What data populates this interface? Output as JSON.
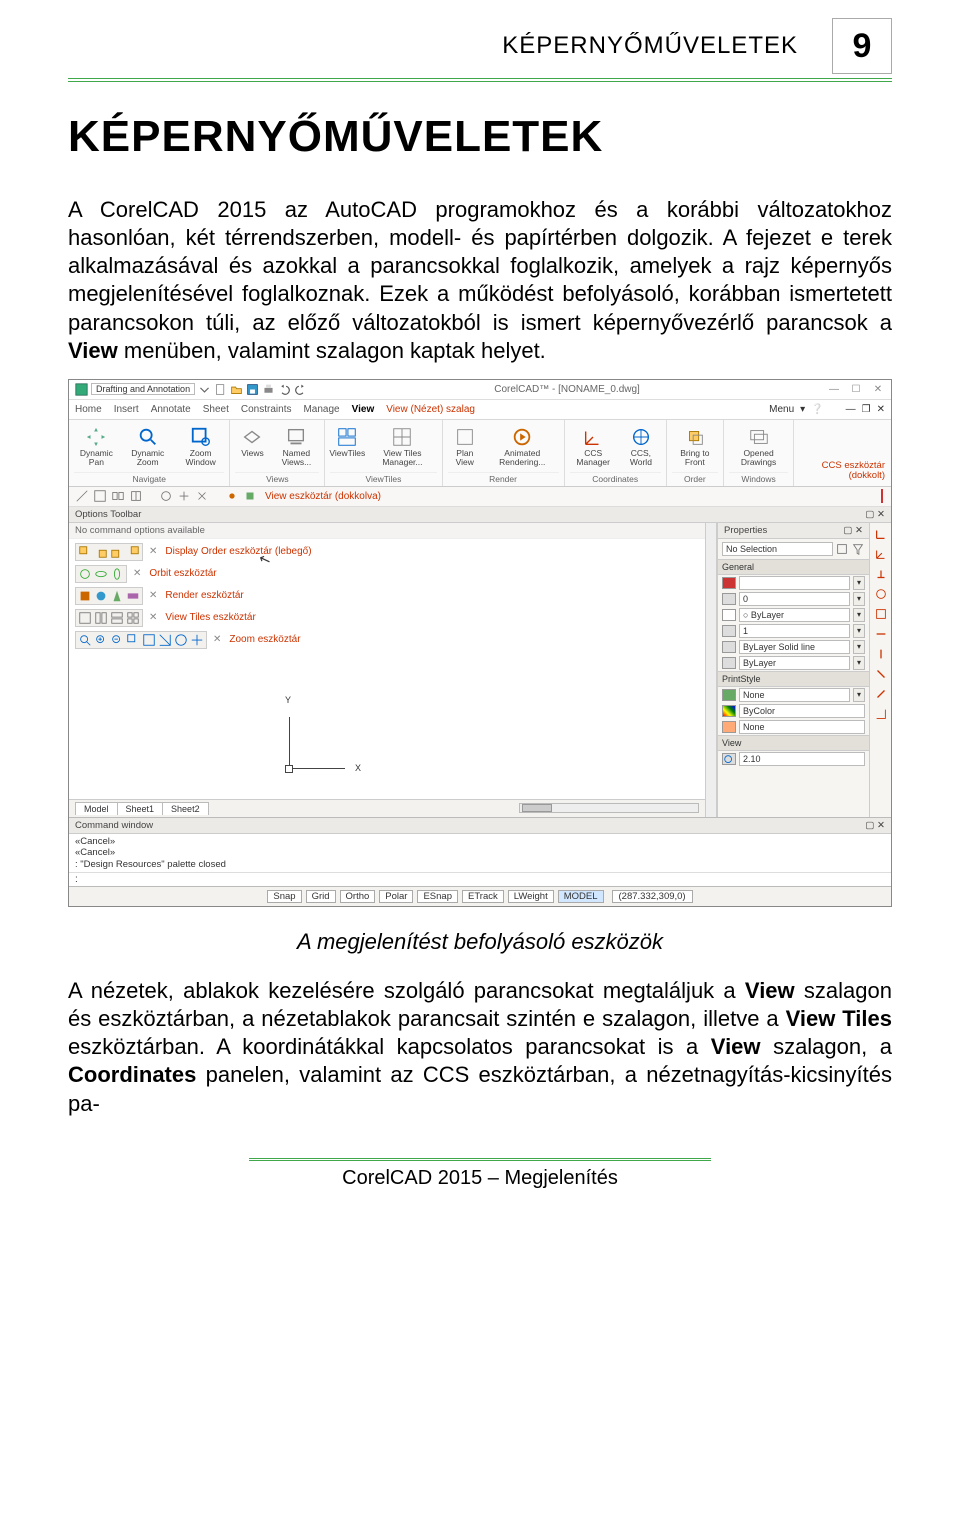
{
  "header": {
    "label": "KÉPERNYŐMŰVELETEK",
    "page_number": "9"
  },
  "title": "KÉPERNYŐMŰVELETEK",
  "p1": "A CorelCAD 2015 az AutoCAD programokhoz és a korábbi változatokhoz hasonlóan, két térrendszerben, modell- és papírtérben dolgozik. A fejezet e terek alkalmazásával és azokkal a parancsokkal foglalkozik, amelyek a rajz képernyős megjelenítésével foglalkoznak. Ezek a működést befolyásoló, korábban ismertetett parancsokon túli, az előző változatokból is ismert képernyővezérlő parancsok a ",
  "p1_bold": "View",
  "p1_tail": " menüben, valamint szalagon kaptak helyet.",
  "caption": "A megjelenítést befolyásoló eszközök",
  "p2a": "A nézetek, ablakok kezelésére szolgáló parancsokat megtaláljuk a ",
  "p2b_bold": "View",
  "p2c": " szalagon és eszköztárban, a nézetablakok parancsait szintén e szalagon, illetve a ",
  "p2d_bold": "View Tiles",
  "p2e": " eszköztárban. A koordinátákkal kapcsolatos parancsokat is a ",
  "p2f_bold": "View",
  "p2g": " szalagon, a ",
  "p2h_bold": "Coordinates",
  "p2i": " panelen, valamint az CCS eszköztárban, a nézetnagyítás-kicsinyítés pa-",
  "footer": "CorelCAD 2015 – Megjelenítés",
  "screenshot": {
    "window_title": "CorelCAD™ - [NONAME_0.dwg]",
    "workspace": "Drafting and Annotation",
    "menu": [
      "Home",
      "Insert",
      "Annotate",
      "Sheet",
      "Constraints",
      "Manage",
      "View"
    ],
    "ribbon_callout": "View (Nézet) szalag",
    "menu_right_label": "Menu",
    "ribbon_groups": {
      "navigate": {
        "title": "Navigate",
        "buttons": [
          "Dynamic Pan",
          "Dynamic Zoom",
          "Zoom Window"
        ]
      },
      "views": {
        "title": "Views",
        "buttons": [
          "Views",
          "Named Views..."
        ]
      },
      "viewtiles": {
        "title": "ViewTiles",
        "buttons": [
          "ViewTiles",
          "View Tiles Manager..."
        ]
      },
      "render": {
        "title": "Render",
        "buttons": [
          "Plan View",
          "Animated Rendering..."
        ]
      },
      "coords": {
        "title": "Coordinates",
        "buttons": [
          "CCS Manager",
          "CCS, World"
        ]
      },
      "order": {
        "title": "Order",
        "buttons": [
          "Bring to Front"
        ]
      },
      "windows": {
        "title": "Windows",
        "buttons": [
          "Opened Drawings"
        ]
      }
    },
    "ccs_side_label": "CCS eszköztár (dokkolt)",
    "view_toolbar_label": "View eszköztár (dokkolva)",
    "options_panel_title": "Options Toolbar",
    "options_msg": "No command options available",
    "floating_toolbars": [
      "Display Order eszköztár (lebegő)",
      "Orbit eszköztár",
      "Render eszköztár",
      "View Tiles eszköztár",
      "Zoom eszköztár"
    ],
    "cursor_arrow": "↖",
    "axis_x": "X",
    "axis_y": "Y",
    "drawing_tabs": [
      "Model",
      "Sheet1",
      "Sheet2"
    ],
    "properties": {
      "panel_title": "Properties",
      "selection": "No Selection",
      "sections": {
        "general": {
          "title": "General",
          "rows": [
            {
              "value": ""
            },
            {
              "value": "0"
            },
            {
              "value": "○ ByLayer"
            },
            {
              "value": "1"
            },
            {
              "value": "ByLayer   Solid line"
            },
            {
              "value": "ByLayer"
            }
          ]
        },
        "printstyle": {
          "title": "PrintStyle",
          "rows": [
            {
              "value": "None"
            },
            {
              "value": "ByColor"
            },
            {
              "value": "None"
            }
          ]
        },
        "view": {
          "title": "View",
          "rows": [
            {
              "value": "2.10"
            }
          ]
        }
      }
    },
    "command_window": {
      "title": "Command window",
      "lines": [
        "«Cancel»",
        "«Cancel»",
        ": \"Design Resources\" palette closed"
      ],
      "prompt": ":"
    },
    "status": {
      "buttons": [
        "Snap",
        "Grid",
        "Ortho",
        "Polar",
        "ESnap",
        "ETrack",
        "LWeight",
        "MODEL"
      ],
      "active": "MODEL",
      "coords": "(287.332,309,0)"
    }
  }
}
